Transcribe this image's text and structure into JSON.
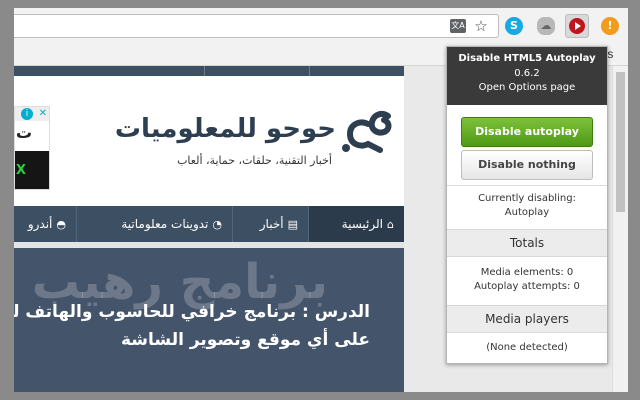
{
  "browser": {
    "bookmark_partial": "oris"
  },
  "ad": {
    "letter": "ت",
    "x_mark": "X",
    "info": "i",
    "close": "✕"
  },
  "site": {
    "logo_title": "حوحو للمعلوميات",
    "logo_tagline": "أخبار التقنية، حلقات، حماية، ألعاب",
    "nav": [
      {
        "label": "الرئيسية"
      },
      {
        "label": "أخبار"
      },
      {
        "label": "تدوينات معلوماتية"
      },
      {
        "label": "أندرو"
      }
    ],
    "hero_watermark": "برنامج رهيب",
    "hero_title": "الدرس : برنامج خرافي للحاسوب والهاتف لتح",
    "hero_subtitle": "على أي موقع وتصوير الشاشة"
  },
  "popup": {
    "title": "Disable HTML5 Autoplay",
    "version": "0.6.2",
    "options_link": "Open Options page",
    "disable_button": "Disable autoplay",
    "nothing_button": "Disable nothing",
    "status_label": "Currently disabling:",
    "status_value": "Autoplay",
    "totals_header": "Totals",
    "media_elements": "Media elements: 0",
    "autoplay_attempts": "Autoplay attempts: 0",
    "players_header": "Media players",
    "players_value": "(None detected)"
  },
  "colors": {
    "nav_bg": "#3d4f63",
    "accent_green": "#5da621",
    "popup_header": "#3a3a3a"
  }
}
